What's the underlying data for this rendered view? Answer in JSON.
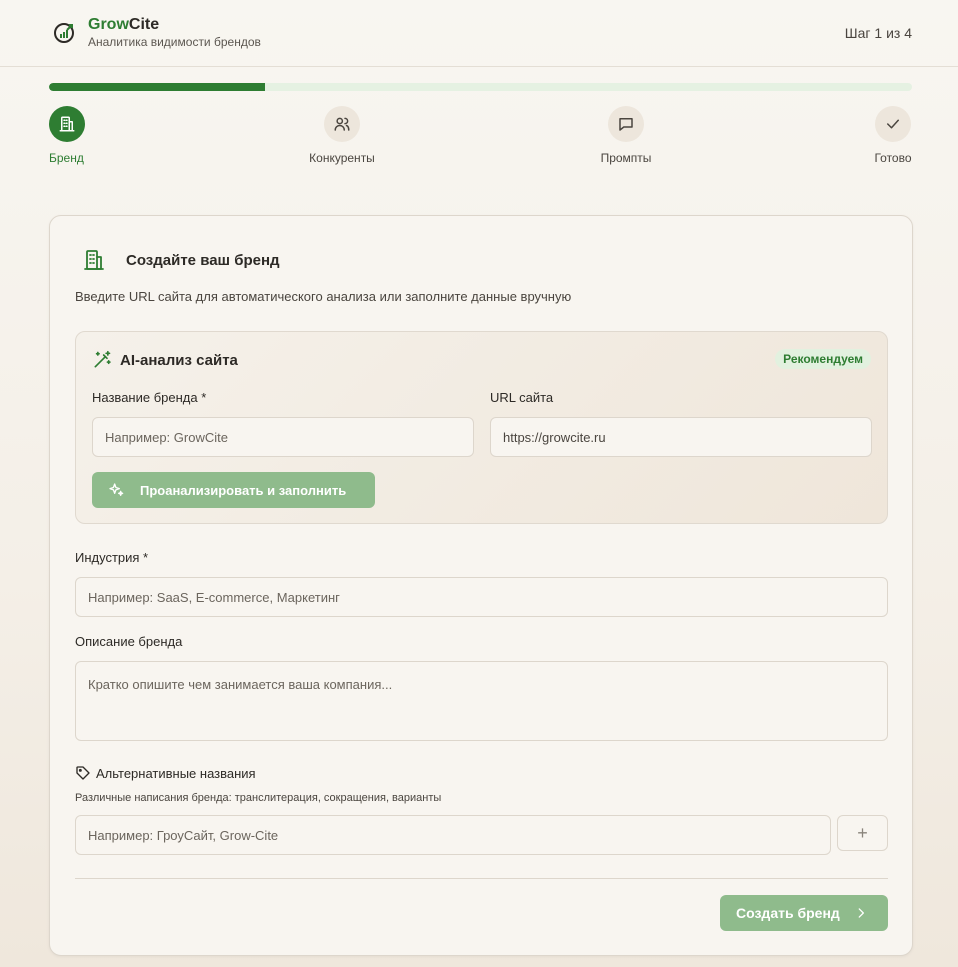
{
  "header": {
    "brand_part1": "Grow",
    "brand_part2": "Cite",
    "subtitle": "Аналитика видимости брендов",
    "step_counter": "Шаг 1 из 4"
  },
  "progress": {
    "current_step": 1,
    "total_steps": 4,
    "fraction": 0.25
  },
  "steps": [
    {
      "label": "Бренд",
      "icon": "building-icon",
      "active": true
    },
    {
      "label": "Конкуренты",
      "icon": "users-icon",
      "active": false
    },
    {
      "label": "Промпты",
      "icon": "message-icon",
      "active": false
    },
    {
      "label": "Готово",
      "icon": "check-icon",
      "active": false
    }
  ],
  "card": {
    "title": "Создайте ваш бренд",
    "description": "Введите URL сайта для автоматического анализа или заполните данные вручную",
    "ai": {
      "title": "AI-анализ сайта",
      "badge": "Рекомендуем",
      "brand_name_label": "Название бренда *",
      "brand_name_placeholder": "Например: GrowCite",
      "url_label": "URL сайта",
      "url_value": "https://growcite.ru",
      "analyze_button": "Проанализировать и заполнить"
    },
    "industry_label": "Индустрия *",
    "industry_placeholder": "Например: SaaS, E-commerce, Маркетинг",
    "description_label": "Описание бренда",
    "description_placeholder": "Кратко опишите чем занимается ваша компания...",
    "alt_names_label": "Альтернативные названия",
    "alt_names_hint": "Различные написания бренда: транслитерация, сокращения, варианты",
    "alt_names_placeholder": "Например: ГроуСайт, Grow-Cite",
    "add_symbol": "+",
    "create_button": "Создать бренд"
  },
  "colors": {
    "accent": "#2e7d32",
    "accent_muted": "#8fbb8c",
    "badge_bg": "#e2f1df"
  }
}
